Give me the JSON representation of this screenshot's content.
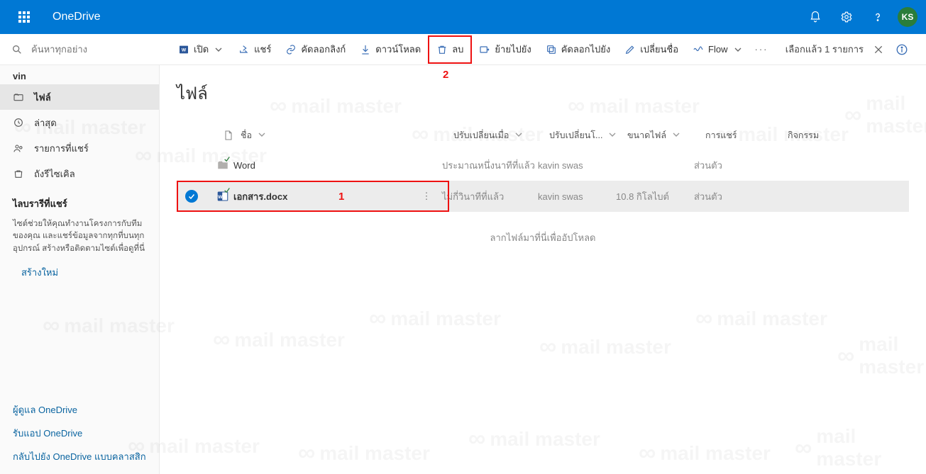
{
  "brand": "OneDrive",
  "avatar": "KS",
  "search": {
    "placeholder": "ค้นหาทุกอย่าง"
  },
  "toolbar": {
    "open": "เปิด",
    "share": "แชร์",
    "copylink": "คัดลอกลิงก์",
    "download": "ดาวน์โหลด",
    "delete": "ลบ",
    "move": "ย้ายไปยัง",
    "copyto": "คัดลอกไปยัง",
    "rename": "เปลี่ยนชื่อ",
    "flow": "Flow",
    "more": "···",
    "selection": "เลือกแล้ว 1 รายการ"
  },
  "sidebar": {
    "owner": "vin",
    "items": [
      {
        "label": "ไฟล์"
      },
      {
        "label": "ล่าสุด"
      },
      {
        "label": "รายการที่แชร์"
      },
      {
        "label": "ถังรีไซเคิล"
      }
    ],
    "section_title": "ไลบรารีที่แชร์",
    "section_desc": "ไซต์ช่วยให้คุณทำงานโครงการกับทีมของคุณ และแชร์ข้อมูลจากทุกที่บนทุกอุปกรณ์ สร้างหรือติดตามไซต์เพื่อดูที่นี่",
    "create_link": "สร้างใหม่",
    "foot1": "ผู้ดูแล OneDrive",
    "foot2": "รับแอป OneDrive",
    "foot3": "กลับไปยัง OneDrive แบบคลาสสิก"
  },
  "page": {
    "title": "ไฟล์"
  },
  "columns": {
    "name": "ชื่อ",
    "modified": "ปรับเปลี่ยนเมื่อ",
    "modified_by": "ปรับเปลี่ยนโ...",
    "size": "ขนาดไฟล์",
    "shared": "การแชร์",
    "activity": "กิจกรรม"
  },
  "rows": [
    {
      "name": "Word",
      "kind": "folder",
      "modified": "ประมาณหนึ่งนาทีที่แล้ว",
      "by": "kavin swas",
      "size": "",
      "shared": "ส่วนตัว",
      "selected": false
    },
    {
      "name": "เอกสาร.docx",
      "kind": "docx",
      "modified": "ไม่กี่วินาทีที่แล้ว",
      "by": "kavin swas",
      "size": "10.8 กิโลไบต์",
      "shared": "ส่วนตัว",
      "selected": true
    }
  ],
  "dropzone": "ลากไฟล์มาที่นี่เพื่ออัปโหลด",
  "annotations": {
    "one": "1",
    "two": "2"
  },
  "watermark": "mail master"
}
